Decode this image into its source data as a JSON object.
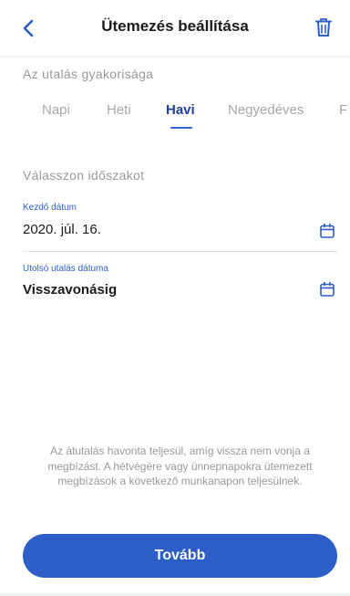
{
  "header": {
    "title": "Ütemezés beállítása",
    "back_icon": "chevron-left-icon",
    "delete_icon": "trash-icon"
  },
  "frequency": {
    "label": "Az utalás gyakorisága",
    "tabs": [
      {
        "label": "Napi",
        "selected": false
      },
      {
        "label": "Heti",
        "selected": false
      },
      {
        "label": "Havi",
        "selected": true
      },
      {
        "label": "Negyedéves",
        "selected": false
      },
      {
        "label": "F",
        "selected": false
      }
    ]
  },
  "period": {
    "label": "Válasszon időszakot",
    "start": {
      "caption": "Kezdő dátum",
      "value": "2020. júl. 16.",
      "icon": "calendar-icon"
    },
    "last": {
      "caption": "Utolsó utalás dátuma",
      "value": "Visszavonásig",
      "icon": "calendar-icon"
    }
  },
  "note": "Az átutalás havonta teljesül, amíg vissza nem vonja a megbízást. A hétvégére vagy ünnepnapokra ütemezett megbízások a következő munkanapon teljesülnek.",
  "actions": {
    "continue_label": "Tovább"
  },
  "colors": {
    "accent": "#2d5dc6",
    "selected_tab": "#1f3f9e",
    "muted_text": "#9a9a9a"
  }
}
